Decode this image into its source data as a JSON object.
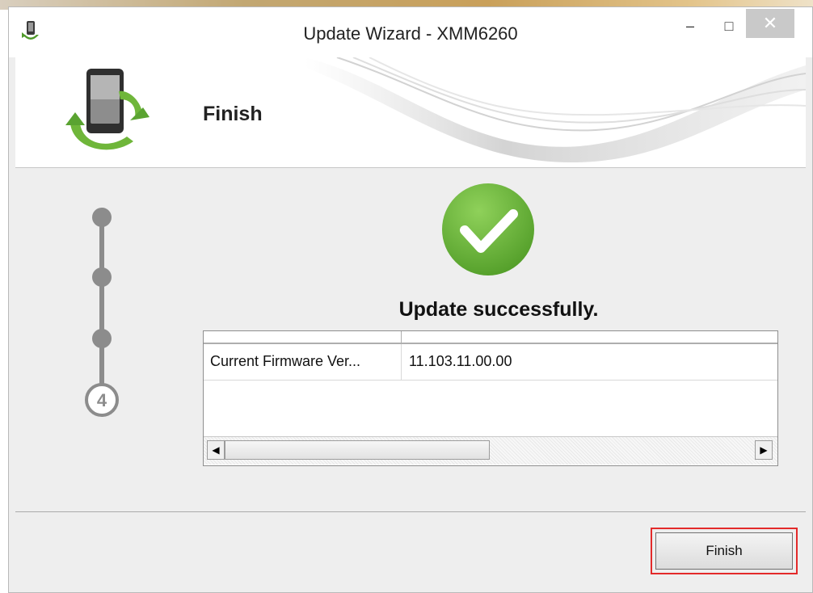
{
  "window": {
    "title": "Update Wizard - XMM6260",
    "minimize_glyph": "–",
    "maximize_glyph": "□",
    "close_glyph": "✕"
  },
  "banner": {
    "step_title": "Finish"
  },
  "steps": {
    "current": "4",
    "total_markers": 4,
    "completed": 3
  },
  "status": {
    "message": "Update successfully."
  },
  "info_table": {
    "columns": [
      "",
      ""
    ],
    "rows": [
      {
        "label": "Current Firmware Ver...",
        "value": "11.103.11.00.00"
      }
    ],
    "scroll_left_glyph": "◀",
    "scroll_right_glyph": "▶"
  },
  "footer": {
    "finish_label": "Finish"
  },
  "colors": {
    "accent_green": "#5aa331",
    "focus_red": "#e32a2a",
    "step_gray": "#8c8c8c"
  },
  "icons": {
    "app": "phone-update-icon",
    "banner": "phone-sync-icon",
    "success": "checkmark-circle-icon"
  }
}
